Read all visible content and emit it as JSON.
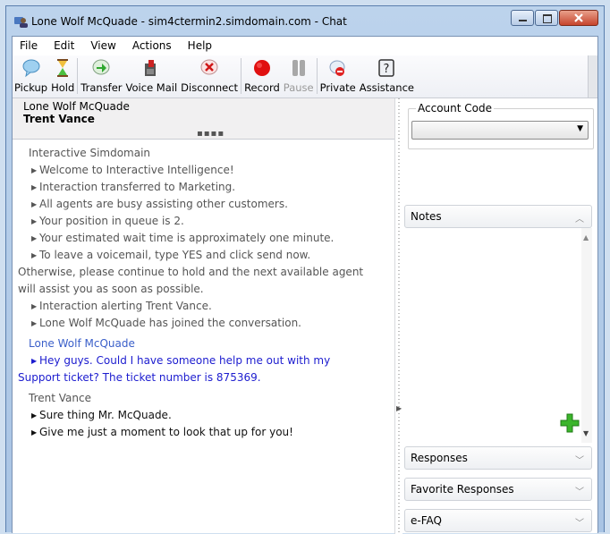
{
  "window": {
    "title": "Lone Wolf McQuade - sim4ctermin2.simdomain.com - Chat",
    "buttons": [
      "minimize",
      "maximize",
      "close"
    ]
  },
  "menu": [
    "File",
    "Edit",
    "View",
    "Actions",
    "Help"
  ],
  "toolbar": [
    {
      "label": "Pickup",
      "icon": "pickup-icon",
      "enabled": true
    },
    {
      "label": "Hold",
      "icon": "hold-icon",
      "enabled": true
    },
    {
      "label": "Transfer",
      "icon": "transfer-icon",
      "enabled": true
    },
    {
      "label": "Voice Mail",
      "icon": "voicemail-icon",
      "enabled": true
    },
    {
      "label": "Disconnect",
      "icon": "disconnect-icon",
      "enabled": true
    },
    {
      "label": "Record",
      "icon": "record-icon",
      "enabled": true
    },
    {
      "label": "Pause",
      "icon": "pause-icon",
      "enabled": false
    },
    {
      "label": "Private",
      "icon": "private-icon",
      "enabled": true
    },
    {
      "label": "Assistance",
      "icon": "assistance-icon",
      "enabled": true
    }
  ],
  "participants": {
    "customer": "Lone Wolf McQuade",
    "agent": "Trent Vance"
  },
  "transcript": {
    "system": {
      "sender": "Interactive Simdomain",
      "lines": [
        "Welcome to Interactive Intelligence!",
        "Interaction transferred to Marketing.",
        "All agents are busy assisting other customers.",
        "Your position in queue is 2.",
        "Your estimated wait time is approximately one minute.",
        "To leave a voicemail, type YES and click send now.",
        "Otherwise, please continue to hold and the next available agent",
        "will assist you as soon as possible.",
        "Interaction alerting Trent Vance.",
        "Lone Wolf McQuade has joined the conversation."
      ]
    },
    "customer": {
      "sender": "Lone Wolf McQuade",
      "lines": [
        "Hey guys.  Could I have someone help me out with my",
        "Support ticket?  The ticket number is 875369."
      ]
    },
    "agent": {
      "sender": "Trent Vance",
      "lines": [
        "Sure thing Mr. McQuade.",
        "Give me just a moment to look that up for you!"
      ]
    }
  },
  "right_panel": {
    "account_code_label": "Account Code",
    "account_code_value": "",
    "notes_label": "Notes",
    "responses_label": "Responses",
    "favorite_responses_label": "Favorite Responses",
    "efaq_label": "e-FAQ"
  },
  "colors": {
    "customer_text": "#1c1ccf",
    "record_red": "#e01010",
    "add_green": "#3bb52b"
  }
}
